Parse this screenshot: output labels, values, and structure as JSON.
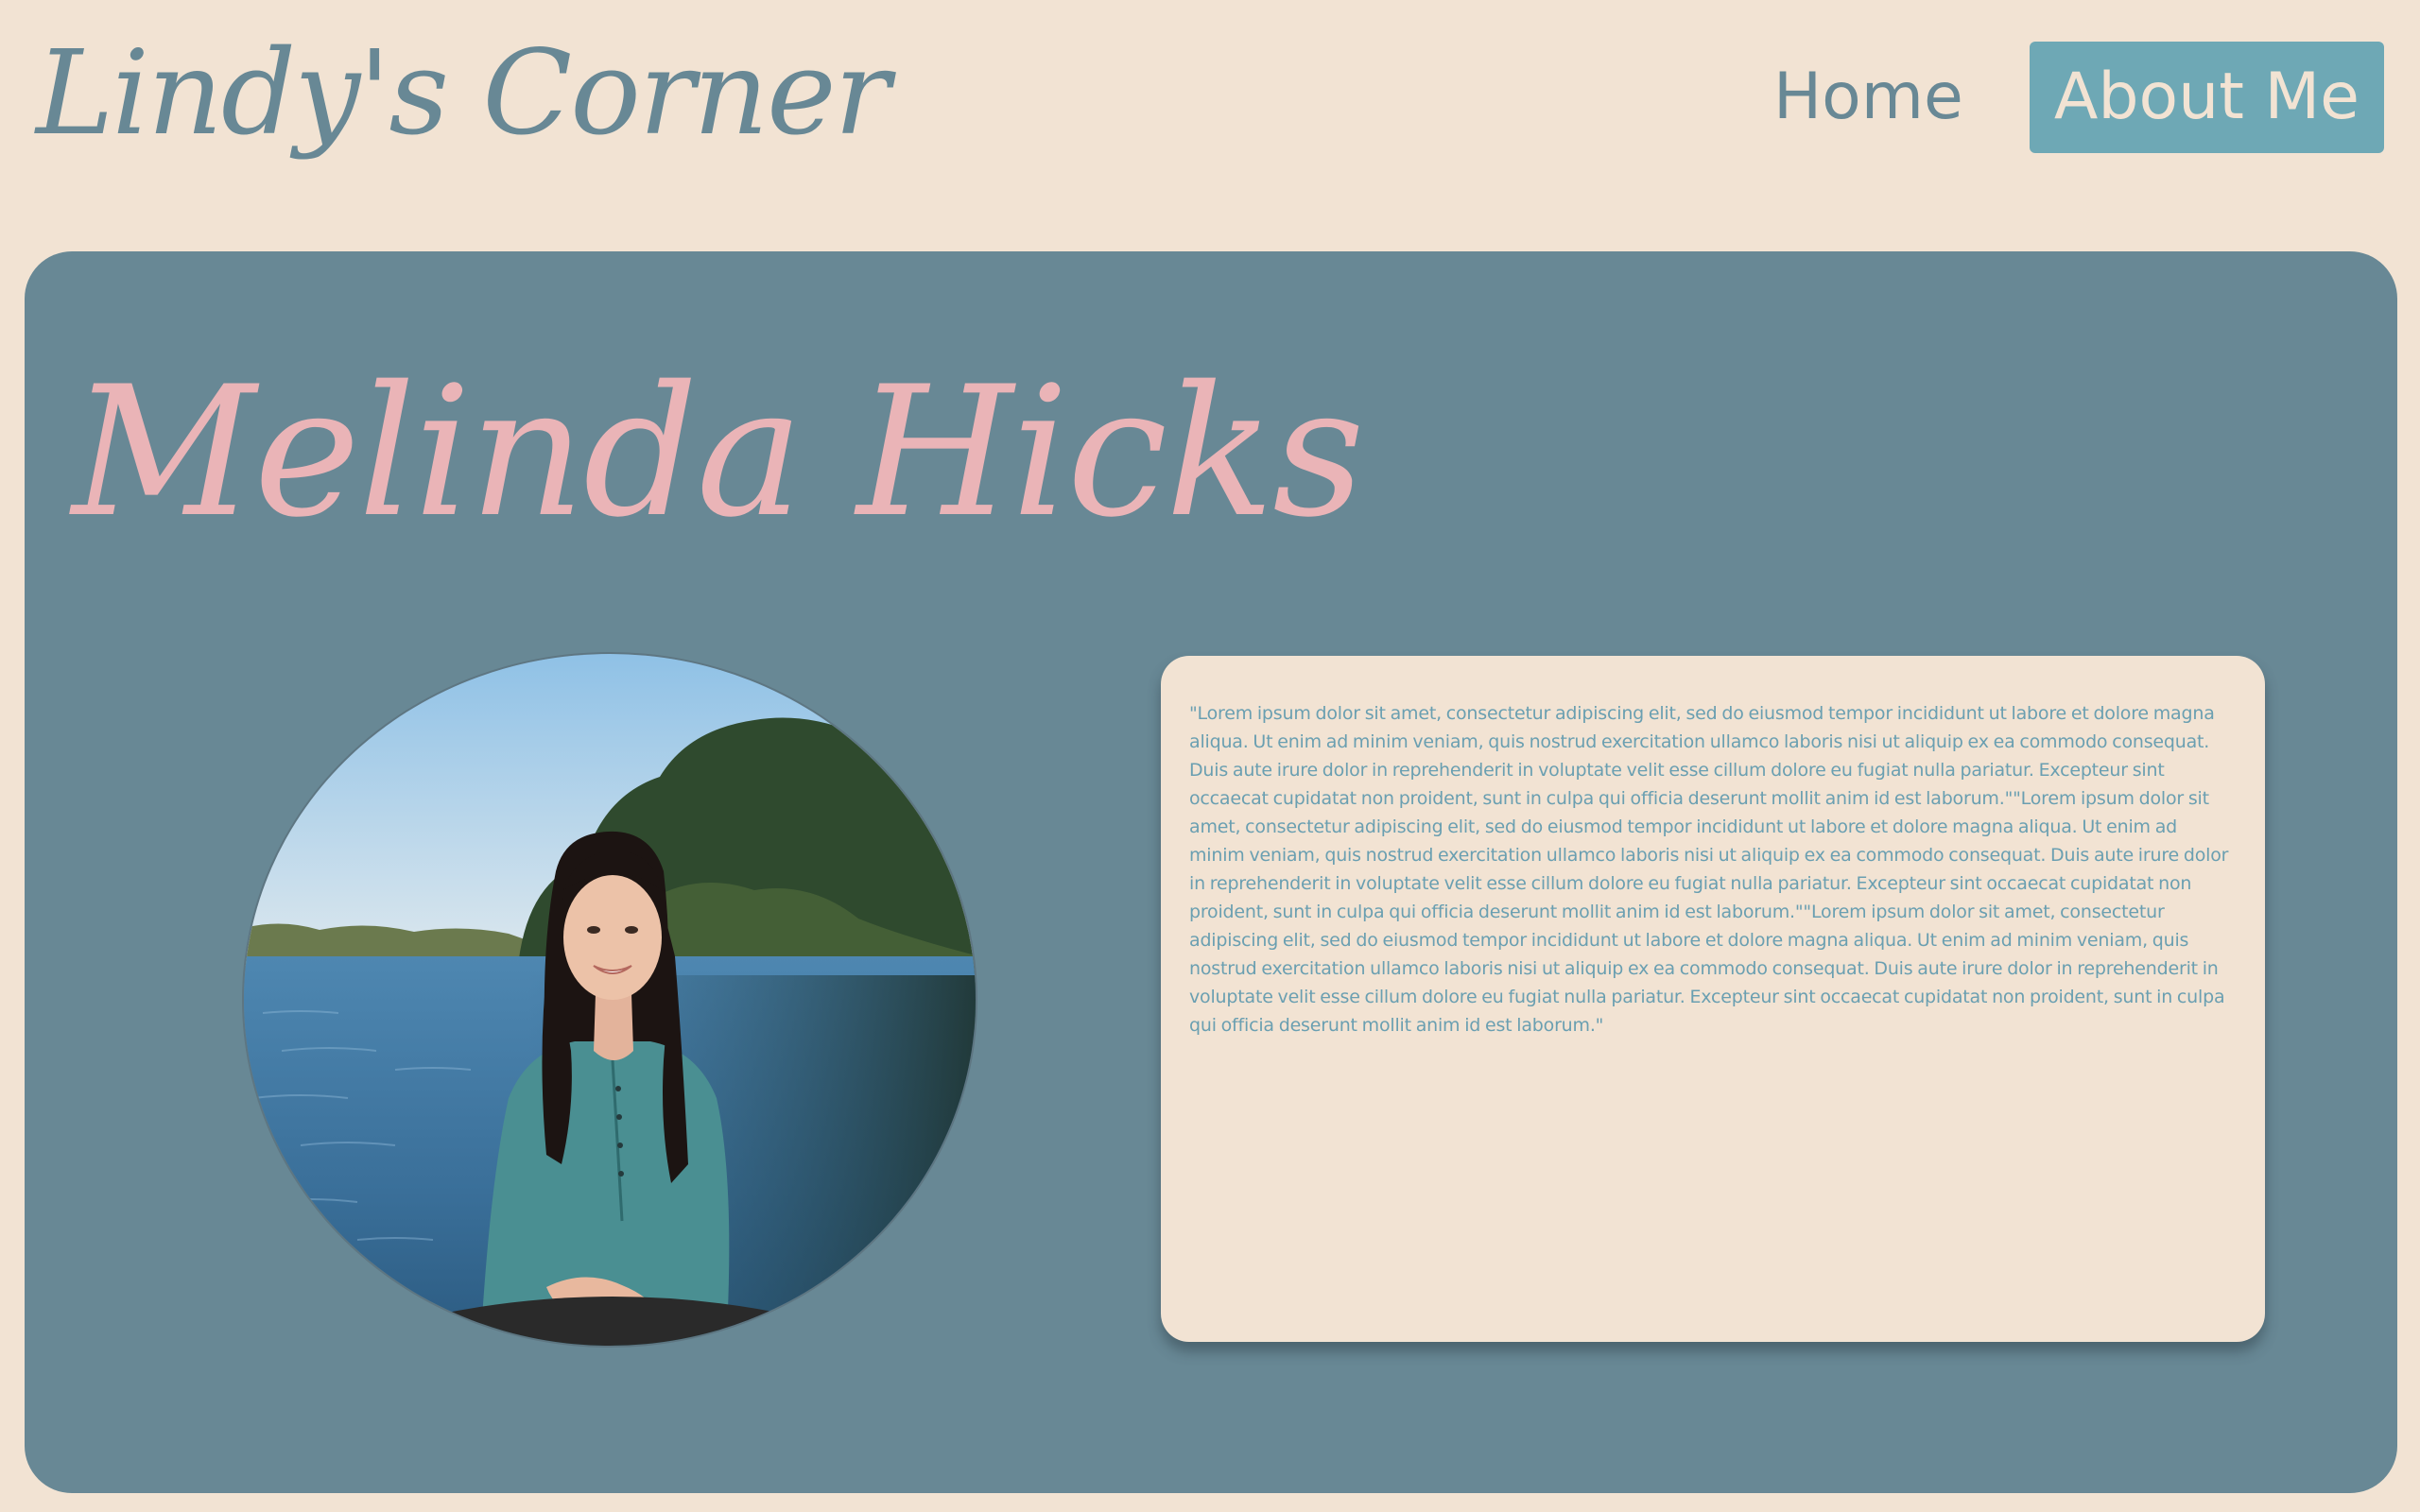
{
  "header": {
    "site_title": "Lindy's Corner",
    "nav": {
      "home_label": "Home",
      "about_label": "About Me"
    }
  },
  "main": {
    "name": "Melinda Hicks",
    "photo_alt": "Portrait of Melinda Hicks",
    "bio": "\"Lorem ipsum dolor sit amet, consectetur adipiscing elit, sed do eiusmod tempor incididunt ut labore et dolore magna aliqua. Ut enim ad minim veniam, quis nostrud exercitation ullamco laboris nisi ut aliquip ex ea commodo consequat. Duis aute irure dolor in reprehenderit in voluptate velit esse cillum dolore eu fugiat nulla pariatur. Excepteur sint occaecat cupidatat non proident, sunt in culpa qui officia deserunt mollit anim id est laborum.\"\"Lorem ipsum dolor sit amet, consectetur adipiscing elit, sed do eiusmod tempor incididunt ut labore et dolore magna aliqua. Ut enim ad minim veniam, quis nostrud exercitation ullamco laboris nisi ut aliquip ex ea commodo consequat. Duis aute irure dolor in reprehenderit in voluptate velit esse cillum dolore eu fugiat nulla pariatur. Excepteur sint occaecat cupidatat non proident, sunt in culpa qui officia deserunt mollit anim id est laborum.\"\"Lorem ipsum dolor sit amet, consectetur adipiscing elit, sed do eiusmod tempor incididunt ut labore et dolore magna aliqua. Ut enim ad minim veniam, quis nostrud exercitation ullamco laboris nisi ut aliquip ex ea commodo consequat. Duis aute irure dolor in reprehenderit in voluptate velit esse cillum dolore eu fugiat nulla pariatur. Excepteur sint occaecat cupidatat non proident, sunt in culpa qui officia deserunt mollit anim id est laborum.\""
  },
  "colors": {
    "page_background": "#f2e3d3",
    "card_background": "#688895",
    "title_text": "#688895",
    "name_text": "#eab4b7",
    "active_nav_background": "#6ea8b5",
    "bio_text": "#6a9fb1"
  }
}
